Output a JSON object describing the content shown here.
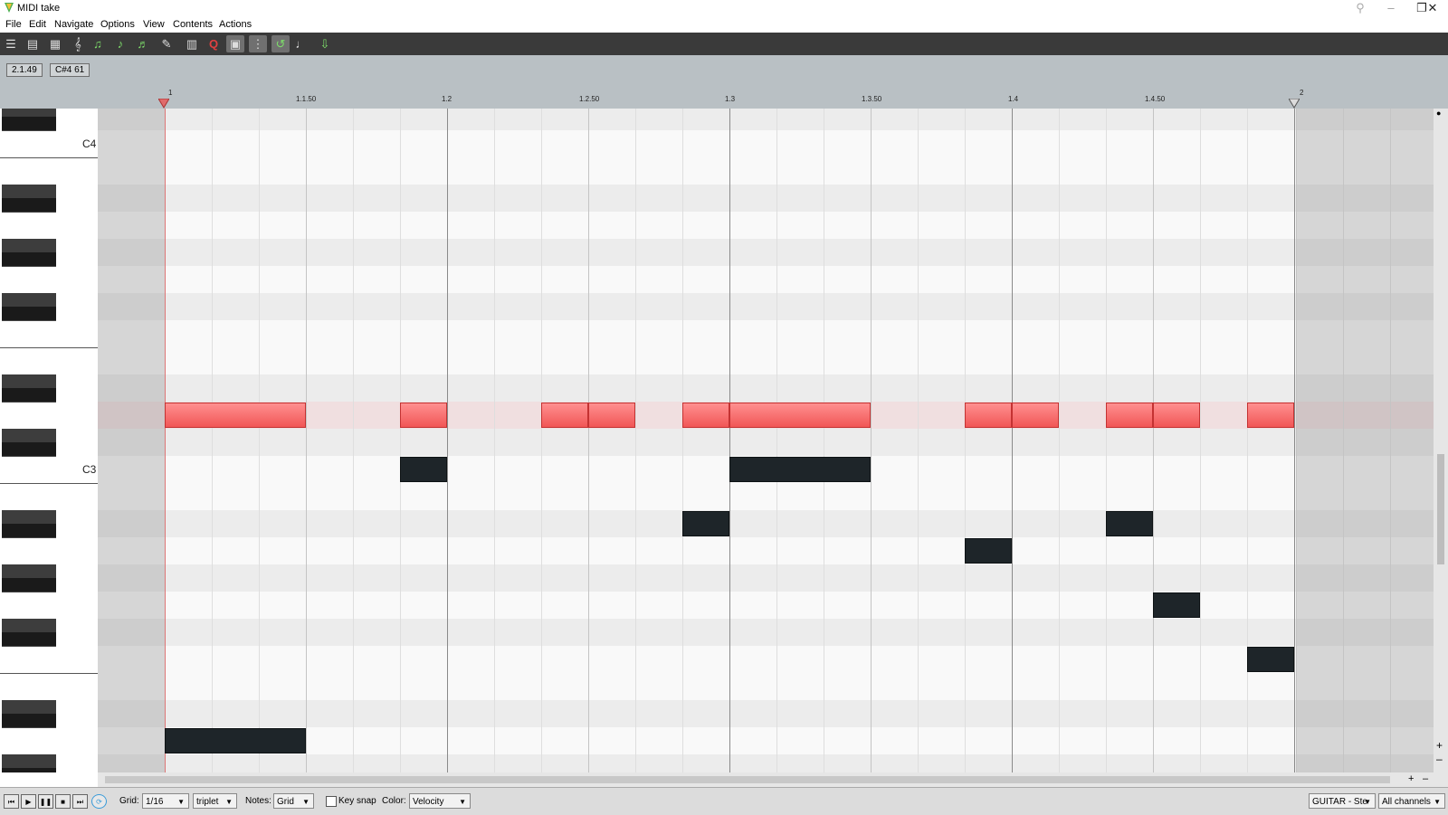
{
  "window": {
    "title": "MIDI take",
    "controls": [
      "minimize-icon",
      "maximize-icon",
      "close-icon"
    ]
  },
  "menu": [
    "File",
    "Edit",
    "Navigate",
    "Options",
    "View",
    "Contents",
    "Actions"
  ],
  "toolbar": {
    "icons": [
      "list-icon",
      "piano-roll-view-icon",
      "drum-grid-view-icon",
      "notation-icon",
      "note-green-icon",
      "note-play-icon",
      "note-select-icon",
      "note-edit-icon",
      "fx-icon",
      "event-list-icon",
      "quantize-icon",
      "fill-icon",
      "grid-icon",
      "loop-icon",
      "record-icon",
      "step-input-icon"
    ]
  },
  "info": {
    "position": "2.1.49",
    "note": "C#4 61"
  },
  "ruler": {
    "labels": [
      "1",
      "1.1.50",
      "1.2",
      "1.2.50",
      "1.3",
      "1.3.50",
      "1.4",
      "1.4.50",
      "2"
    ]
  },
  "keyboard": {
    "labels": [
      "C4",
      "C3"
    ]
  },
  "notes_selected": [
    {
      "start": "1.1.00",
      "length": "3 cells"
    },
    {
      "start": "1.1.75",
      "length": "1 cell"
    },
    {
      "start": "1.2.50",
      "length": "1 cell"
    },
    {
      "start": "1.2.75",
      "length": "1 cell"
    },
    {
      "start": "1.3.00",
      "length": "1 cell"
    },
    {
      "start": "1.3.25",
      "length": "3 cells"
    },
    {
      "start": "1.4.00",
      "length": "1 cell"
    },
    {
      "start": "1.4.25",
      "length": "1 cell"
    },
    {
      "start": "1.4.50",
      "length": "1 cell"
    },
    {
      "start": "1.4.75",
      "length": "1 cell"
    },
    {
      "start": "1.4.100",
      "length": "1 cell"
    }
  ],
  "bottom": {
    "grid_label": "Grid:",
    "grid_value": "1/16",
    "grid_type": "triplet",
    "notes_label": "Notes:",
    "notes_value": "Grid",
    "keysnap_label": "Key snap",
    "color_label": "Color:",
    "color_value": "Velocity",
    "track": "GUITAR - Ste",
    "channel": "All channels"
  },
  "colors": {
    "selected_note": "#f15656",
    "unselected_note": "#1e2529",
    "toolbar_bg": "#3a3a3a"
  }
}
